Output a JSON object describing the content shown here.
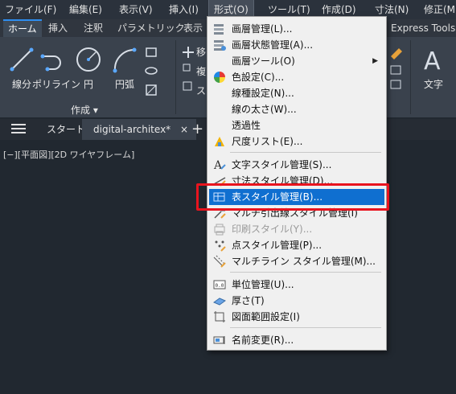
{
  "menubar": {
    "items": [
      {
        "label": "ファイル(F)"
      },
      {
        "label": "編集(E)"
      },
      {
        "label": "表示(V)"
      },
      {
        "label": "挿入(I)"
      },
      {
        "label": "形式(O)"
      },
      {
        "label": "ツール(T)"
      },
      {
        "label": "作成(D)"
      },
      {
        "label": "寸法(N)"
      },
      {
        "label": "修正(M"
      }
    ]
  },
  "ribbon_tabs": {
    "items": [
      {
        "label": "ホーム"
      },
      {
        "label": "挿入"
      },
      {
        "label": "注釈"
      },
      {
        "label": "パラメトリック"
      },
      {
        "label": "表示"
      },
      {
        "label": "Express Tools"
      }
    ]
  },
  "ribbon": {
    "tools": [
      {
        "label": "線分"
      },
      {
        "label": "ポリライン"
      },
      {
        "label": "円"
      },
      {
        "label": "円弧"
      },
      {
        "label": "文字"
      }
    ],
    "panel_title": "作成 ▾",
    "partial_labels": [
      "移",
      "複",
      "ス"
    ]
  },
  "doc_tabs": {
    "start_label": "スタート",
    "active_label": "digital-architex*",
    "close_glyph": "×",
    "add_glyph": "+"
  },
  "viewport": {
    "label": "[−][平面図][2D ワイヤフレーム]"
  },
  "dropdown": {
    "items": [
      {
        "label": "画層管理(L)...",
        "icon": "layer-manager-icon"
      },
      {
        "label": "画層状態管理(A)...",
        "icon": "layer-state-icon"
      },
      {
        "label": "画層ツール(O)",
        "icon": "none",
        "submenu": true
      },
      {
        "label": "色設定(C)...",
        "icon": "color-wheel-icon"
      },
      {
        "label": "線種設定(N)...",
        "icon": "none"
      },
      {
        "label": "線の太さ(W)...",
        "icon": "none"
      },
      {
        "label": "透過性",
        "icon": "none"
      },
      {
        "label": "尺度リスト(E)...",
        "icon": "scale-list-icon"
      },
      {
        "label": "文字スタイル管理(S)...",
        "icon": "text-style-icon"
      },
      {
        "label": "寸法スタイル管理(D)...",
        "icon": "dim-style-icon"
      },
      {
        "label": "表スタイル管理(B)...",
        "icon": "table-style-icon",
        "highlight": true
      },
      {
        "label": "マルチ引出線スタイル管理(I)",
        "icon": "mleader-style-icon"
      },
      {
        "label": "印刷スタイル(Y)...",
        "icon": "plot-style-icon",
        "disabled": true
      },
      {
        "label": "点スタイル管理(P)...",
        "icon": "point-style-icon"
      },
      {
        "label": "マルチライン スタイル管理(M)...",
        "icon": "mline-style-icon"
      },
      {
        "label": "単位管理(U)...",
        "icon": "units-icon"
      },
      {
        "label": "厚さ(T)",
        "icon": "thickness-icon"
      },
      {
        "label": "図面範囲設定(I)",
        "icon": "limits-icon"
      },
      {
        "label": "名前変更(R)...",
        "icon": "rename-icon"
      }
    ]
  },
  "colors": {
    "highlight": "#0f6fd0",
    "annotation_box": "#e8141e",
    "menu_bg": "#f0f0f0",
    "app_bg": "#212830"
  }
}
